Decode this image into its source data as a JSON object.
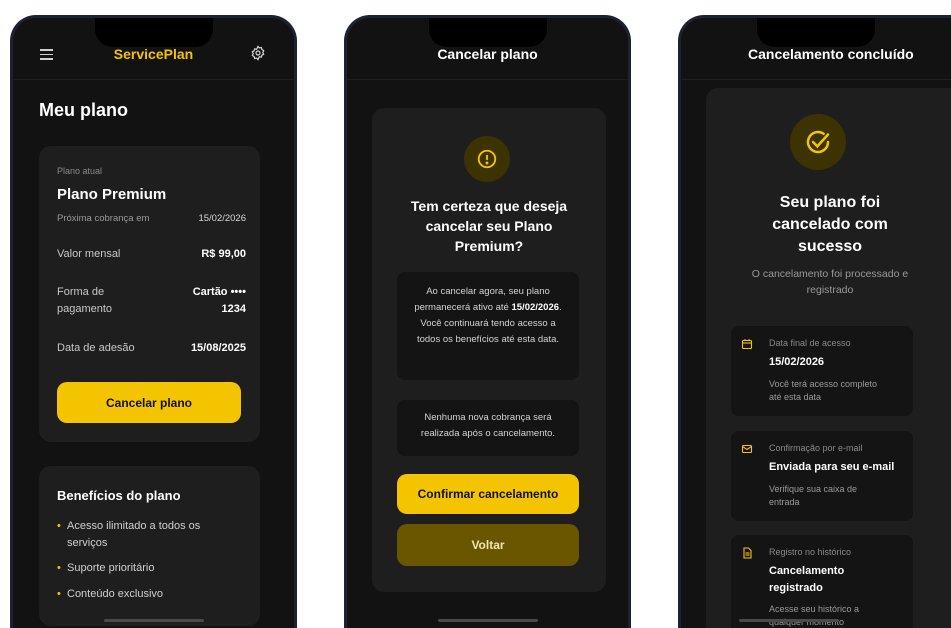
{
  "screen1": {
    "brand": "ServicePlan",
    "page_title": "Meu plano",
    "plan": {
      "label": "Plano atual",
      "name": "Plano Premium",
      "next_billing_label": "Próxima cobrança em",
      "next_billing_value": "15/02/2026",
      "monthly_label": "Valor mensal",
      "monthly_value": "R$ 99,00",
      "payment_label_1": "Forma de",
      "payment_label_2": "pagamento",
      "payment_value_1": "Cartão ••••",
      "payment_value_2": "1234",
      "join_label": "Data de adesão",
      "join_value": "15/08/2025",
      "cancel_button": "Cancelar plano"
    },
    "benefits": {
      "title": "Benefícios do plano",
      "items": [
        "Acesso ilimitado a todos os serviços",
        "Suporte prioritário",
        "Conteúdo exclusivo"
      ]
    }
  },
  "screen2": {
    "title": "Cancelar plano",
    "modal_title": "Tem certeza que deseja cancelar seu Plano Premium?",
    "box1_part1": "Ao cancelar agora, seu plano permanecerá ativo até ",
    "box1_date": "15/02/2026",
    "box1_part2": ". Você continuará tendo acesso a todos os benefícios até esta data.",
    "box2": "Nenhuma nova cobrança será realizada após o cancelamento.",
    "confirm_button": "Confirmar cancelamento",
    "back_button": "Voltar"
  },
  "screen3": {
    "title": "Cancelamento concluído",
    "headline": "Seu plano foi cancelado com sucesso",
    "subtitle": "O cancelamento foi processado e registrado",
    "cards": [
      {
        "label": "Data final de acesso",
        "value": "15/02/2026",
        "desc": "Você terá acesso completo até esta data"
      },
      {
        "label": "Confirmação por e-mail",
        "value": "Enviada para seu e-mail",
        "desc": "Verifique sua caixa de entrada"
      },
      {
        "label": "Registro no histórico",
        "value": "Cancelamento registrado",
        "desc": "Acesse seu histórico a qualquer momento"
      }
    ]
  },
  "colors": {
    "accent": "#f5c400",
    "background": "#121212",
    "card": "#1e1e1e"
  }
}
